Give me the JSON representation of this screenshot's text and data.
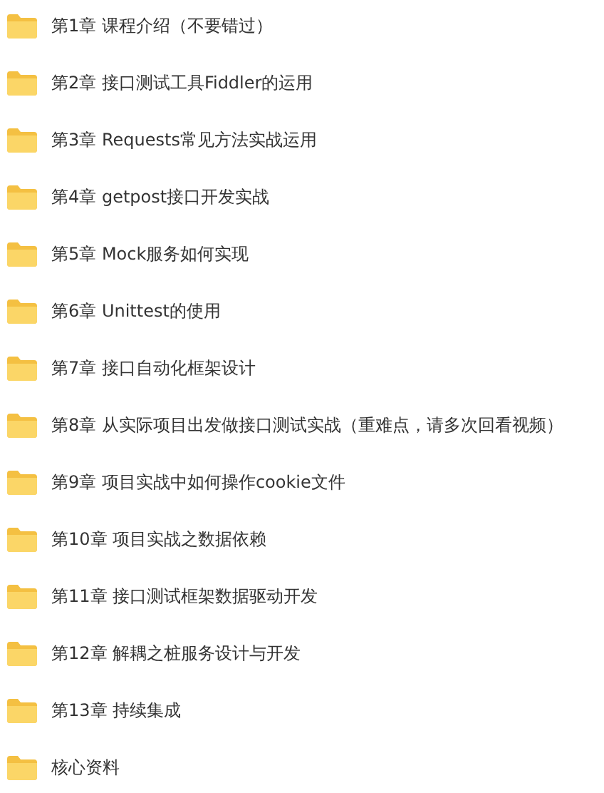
{
  "folders": [
    {
      "name": "第1章 课程介绍（不要错过）"
    },
    {
      "name": "第2章 接口测试工具Fiddler的运用"
    },
    {
      "name": "第3章 Requests常见方法实战运用"
    },
    {
      "name": "第4章 getpost接口开发实战"
    },
    {
      "name": "第5章 Mock服务如何实现"
    },
    {
      "name": "第6章 Unittest的使用"
    },
    {
      "name": "第7章 接口自动化框架设计"
    },
    {
      "name": "第8章 从实际项目出发做接口测试实战（重难点，请多次回看视频）"
    },
    {
      "name": "第9章 项目实战中如何操作cookie文件"
    },
    {
      "name": "第10章 项目实战之数据依赖"
    },
    {
      "name": "第11章 接口测试框架数据驱动开发"
    },
    {
      "name": "第12章 解耦之桩服务设计与开发"
    },
    {
      "name": "第13章 持续集成"
    },
    {
      "name": "核心资料"
    }
  ]
}
